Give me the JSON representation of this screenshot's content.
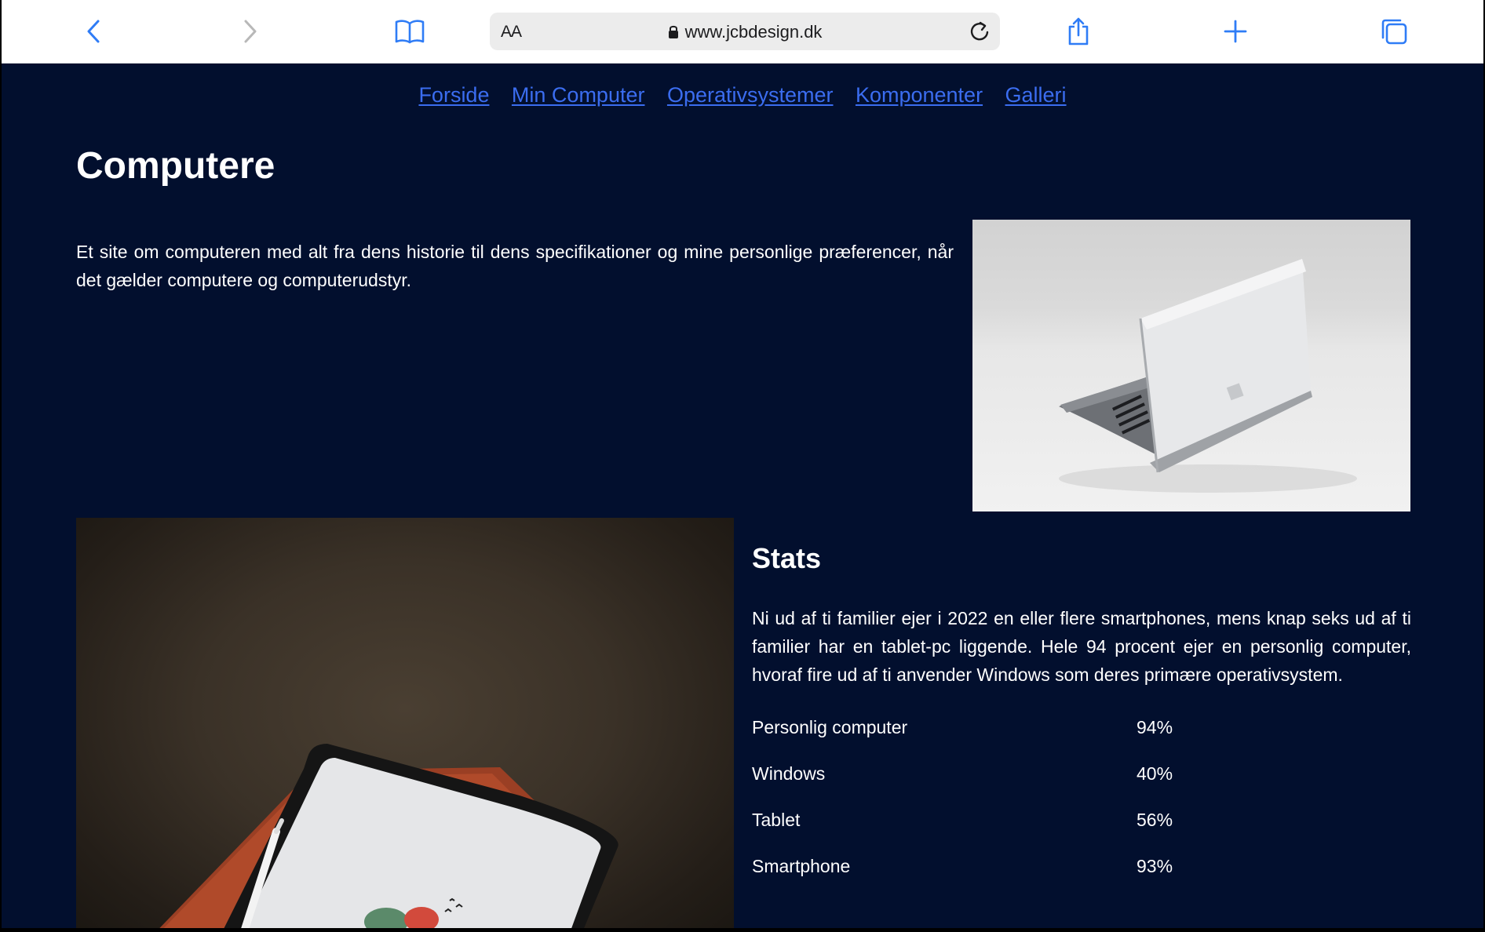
{
  "browser": {
    "reader_label": "AA",
    "url": "www.jcbdesign.dk",
    "icons": [
      "back-icon",
      "forward-icon",
      "bookmarks-icon",
      "lock-icon",
      "reload-icon",
      "share-icon",
      "new-tab-icon",
      "tabs-icon"
    ]
  },
  "nav": {
    "items": [
      "Forside",
      "Min Computer",
      "Operativsystemer",
      "Komponenter",
      "Galleri"
    ]
  },
  "page": {
    "title": "Computere",
    "intro": "Et site om computeren med alt fra dens historie til dens specifikationer og mine personlige præferencer, når det gælder computere og computerudstyr."
  },
  "stats": {
    "title": "Stats",
    "text": "Ni ud af ti familier ejer i 2022 en eller flere smartphones, mens knap seks ud af ti familier har en tablet-pc liggende. Hele 94 procent ejer en personlig computer, hvoraf fire ud af ti anvender Windows som deres primære operativsystem.",
    "rows": [
      {
        "label": "Personlig computer",
        "value": "94%"
      },
      {
        "label": "Windows",
        "value": "40%"
      },
      {
        "label": "Tablet",
        "value": "56%"
      },
      {
        "label": "Smartphone",
        "value": "93%"
      }
    ]
  },
  "colors": {
    "page_background": "#020f2e",
    "link": "#3b6df0",
    "text": "#ffffff",
    "toolbar_accent": "#2f7cf6"
  }
}
